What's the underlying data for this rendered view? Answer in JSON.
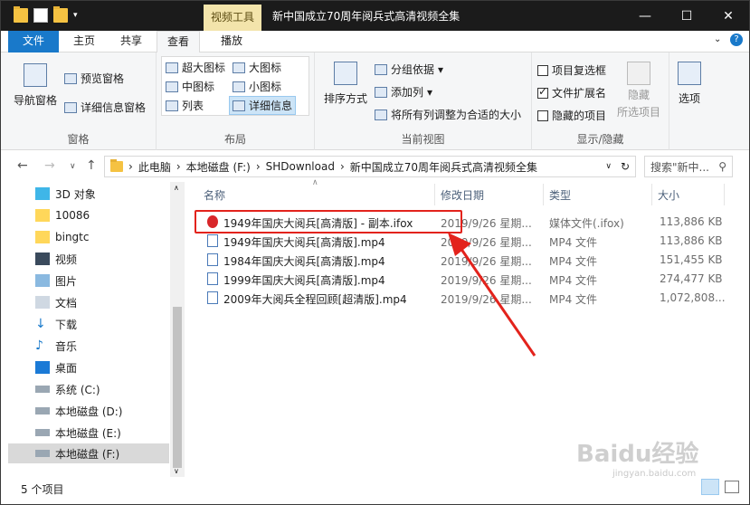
{
  "titlebar": {
    "context_tab": "视频工具",
    "title": "新中国成立70周年阅兵式高清视频全集"
  },
  "tabs": {
    "file": "文件",
    "home": "主页",
    "share": "共享",
    "view": "查看",
    "play": "播放"
  },
  "ribbon": {
    "pane": {
      "nav_pane": "导航窗格",
      "preview": "预览窗格",
      "details_pane": "详细信息窗格",
      "label": "窗格"
    },
    "layout": {
      "xl": "超大图标",
      "large": "大图标",
      "medium": "中图标",
      "small": "小图标",
      "list": "列表",
      "details": "详细信息",
      "label": "布局"
    },
    "view": {
      "sort": "排序方式",
      "group": "分组依据",
      "add_col": "添加列",
      "fit_cols": "将所有列调整为合适的大小",
      "label": "当前视图"
    },
    "showhide": {
      "item_cb": "项目复选框",
      "ext": "文件扩展名",
      "hidden": "隐藏的项目",
      "hide": "隐藏",
      "hide2": "所选项目",
      "label": "显示/隐藏"
    },
    "options": "选项"
  },
  "address": {
    "crumbs": [
      "此电脑",
      "本地磁盘 (F:)",
      "SHDownload",
      "新中国成立70周年阅兵式高清视频全集"
    ],
    "search_placeholder": "搜索\"新中..."
  },
  "nav": [
    "3D 对象",
    "10086",
    "bingtc",
    "视频",
    "图片",
    "文档",
    "下载",
    "音乐",
    "桌面",
    "系统 (C:)",
    "本地磁盘 (D:)",
    "本地磁盘 (E:)",
    "本地磁盘 (F:)"
  ],
  "columns": {
    "name": "名称",
    "date": "修改日期",
    "type": "类型",
    "size": "大小"
  },
  "files": [
    {
      "name": "1949年国庆大阅兵[高清版] - 副本.ifox",
      "date": "2019/9/26 星期...",
      "type": "媒体文件(.ifox)",
      "size": "113,886 KB"
    },
    {
      "name": "1949年国庆大阅兵[高清版].mp4",
      "date": "2019/9/26 星期...",
      "type": "MP4 文件",
      "size": "113,886 KB"
    },
    {
      "name": "1984年国庆大阅兵[高清版].mp4",
      "date": "2019/9/26 星期...",
      "type": "MP4 文件",
      "size": "151,455 KB"
    },
    {
      "name": "1999年国庆大阅兵[高清版].mp4",
      "date": "2019/9/26 星期...",
      "type": "MP4 文件",
      "size": "274,477 KB"
    },
    {
      "name": "2009年大阅兵全程回顾[超清版].mp4",
      "date": "2019/9/26 星期...",
      "type": "MP4 文件",
      "size": "1,072,808..."
    }
  ],
  "status": {
    "count": "5 个项目"
  },
  "watermark": {
    "main": "Baidu经验",
    "sub": "jingyan.baidu.com"
  },
  "colors": {
    "accent": "#1979ca",
    "highlight": "#e3231c"
  }
}
